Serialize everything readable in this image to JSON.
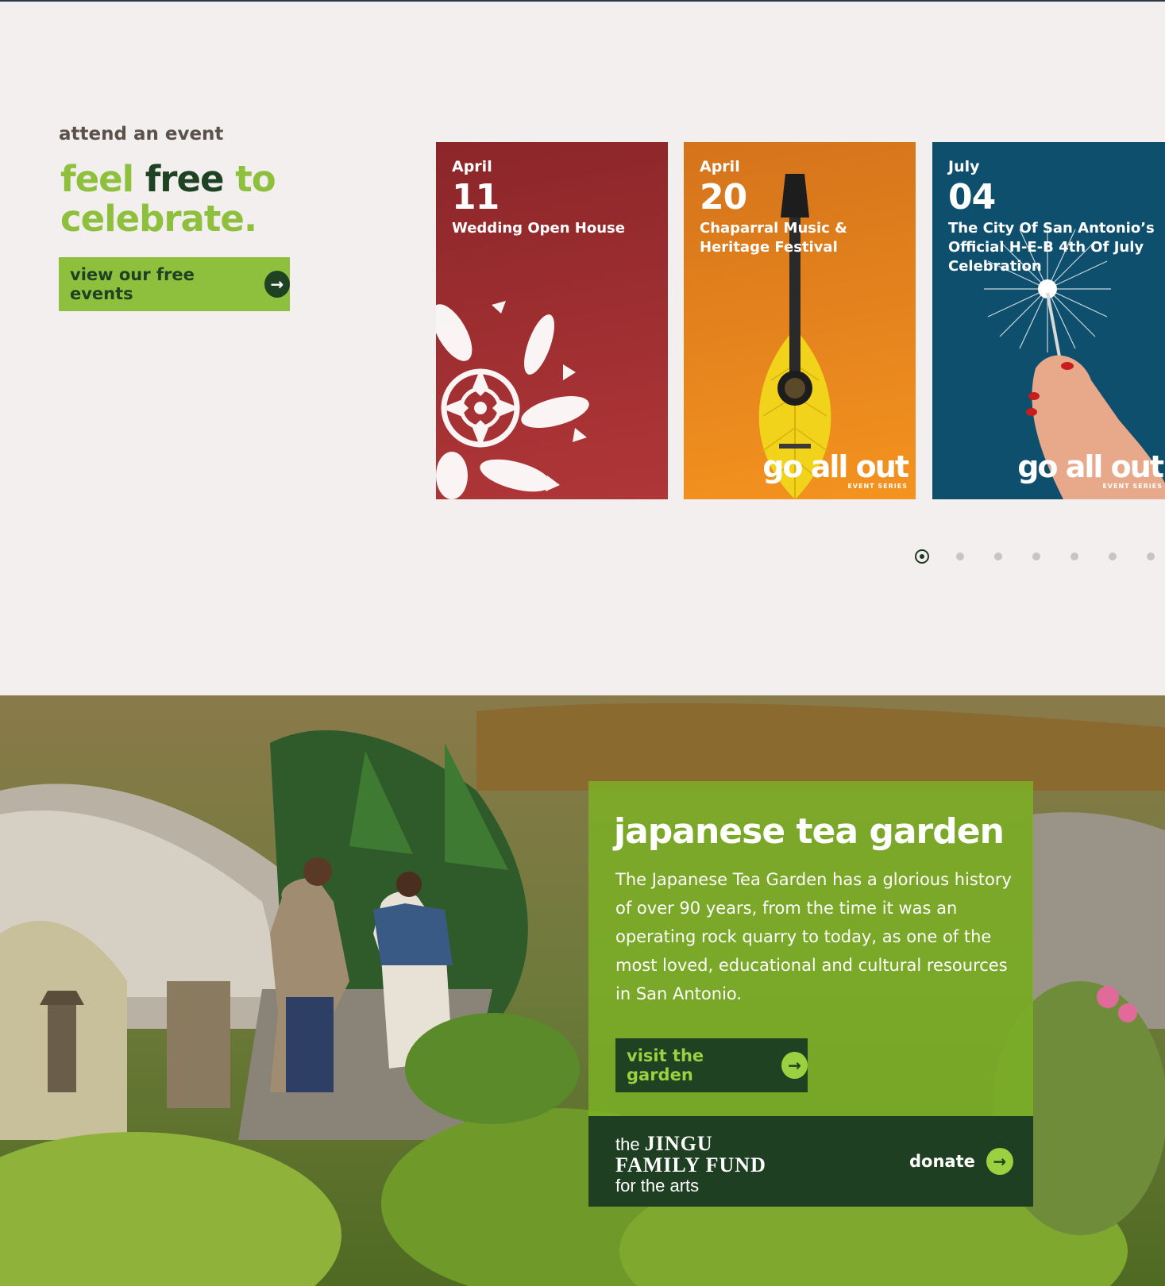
{
  "events": {
    "eyebrow": "attend an event",
    "headline": {
      "part1": "feel",
      "part2": "free",
      "part3": "to",
      "part4": "celebrate."
    },
    "button_label": "view our free events",
    "cards": [
      {
        "month": "April",
        "day": "11",
        "title": "Wedding Open House",
        "brand": "",
        "brand_sub": ""
      },
      {
        "month": "April",
        "day": "20",
        "title": "Chaparral Music & Heritage Festival",
        "brand": "go all out",
        "brand_sub": "EVENT SERIES"
      },
      {
        "month": "July",
        "day": "04",
        "title": "The City Of San Antonio’s Official H-E-B 4th Of July Celebration",
        "brand": "go all out",
        "brand_sub": "EVENT SERIES"
      }
    ],
    "carousel": {
      "total_pages": 7,
      "active_page": 1
    }
  },
  "garden": {
    "title": "japanese tea garden",
    "description": "The Japanese Tea Garden has a glorious history of over 90 years, from the time it was an operating rock quarry to today, as one of the most loved, educational and cultural resources in San Antonio.",
    "button_label": "visit the garden",
    "fund": {
      "line1_prefix": "the",
      "line1_name": "JINGU",
      "line2": "FAMILY FUND",
      "line3": "for the arts"
    },
    "donate_label": "donate"
  },
  "icons": {
    "arrow": "arrow-right-icon"
  },
  "colors": {
    "brand_green": "#8fc03d",
    "dark_green": "#1e4222",
    "background": "#f3efee",
    "card_red": "#a43234",
    "card_orange": "#ea8a1e",
    "card_teal": "#0d4f6c"
  }
}
